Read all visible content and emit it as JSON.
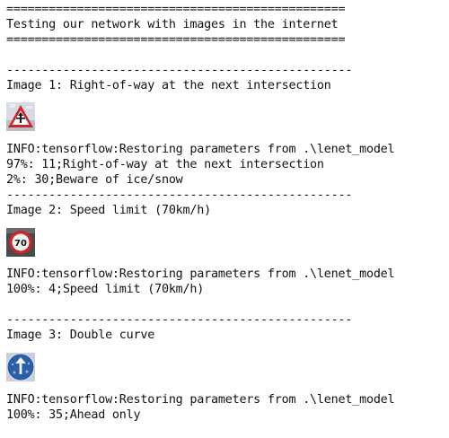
{
  "header": {
    "rule": "================================================",
    "title": "Testing our network with images in the internet"
  },
  "separator": "-------------------------------------------------",
  "results": [
    {
      "image_title": "Image 1: Right-of-way at the next intersection",
      "thumbnail_icon": "right-of-way-sign-icon",
      "info": "INFO:tensorflow:Restoring parameters from .\\lenet_model",
      "predictions": [
        "97%: 11;Right-of-way at the next intersection",
        "2%: 30;Beware of ice/snow"
      ]
    },
    {
      "image_title": "Image 2: Speed limit (70km/h)",
      "thumbnail_icon": "speed-limit-70-sign-icon",
      "thumbnail_text": "70",
      "info": "INFO:tensorflow:Restoring parameters from .\\lenet_model",
      "predictions": [
        "100%: 4;Speed limit (70km/h)"
      ]
    },
    {
      "image_title": "Image 3: Double curve",
      "thumbnail_icon": "blue-circle-sign-icon",
      "info": "INFO:tensorflow:Restoring parameters from .\\lenet_model",
      "predictions": [
        "100%: 35;Ahead only"
      ]
    }
  ],
  "colors": {
    "background": "#ffffff",
    "text": "#111111",
    "sign_red": "#c8262b",
    "sign_blue": "#2a5fa8"
  }
}
